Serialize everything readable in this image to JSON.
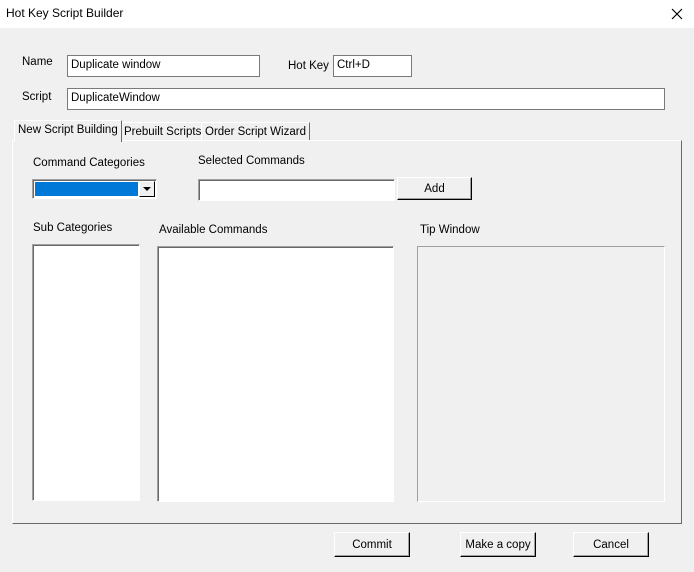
{
  "window": {
    "title": "Hot Key Script Builder"
  },
  "form": {
    "name_label": "Name",
    "name_value": "Duplicate window",
    "hotkey_label": "Hot Key",
    "hotkey_value": "Ctrl+D",
    "script_label": "Script",
    "script_value": "DuplicateWindow"
  },
  "tabs": [
    {
      "label": "New Script Building",
      "active": true
    },
    {
      "label": "Prebuilt Scripts",
      "active": false
    },
    {
      "label": "Order Script Wizard",
      "active": false
    }
  ],
  "panel": {
    "command_categories_label": "Command Categories",
    "command_categories_value": "",
    "selected_commands_label": "Selected Commands",
    "selected_commands_value": "",
    "add_label": "Add",
    "sub_categories_label": "Sub Categories",
    "available_commands_label": "Available Commands",
    "tip_window_label": "Tip Window"
  },
  "footer": {
    "commit_label": "Commit",
    "make_copy_label": "Make a copy",
    "cancel_label": "Cancel"
  },
  "icons": {
    "close": "close-icon",
    "dropdown": "chevron-down-icon"
  },
  "colors": {
    "selection": "#0078d7",
    "face": "#f0f0f0"
  }
}
